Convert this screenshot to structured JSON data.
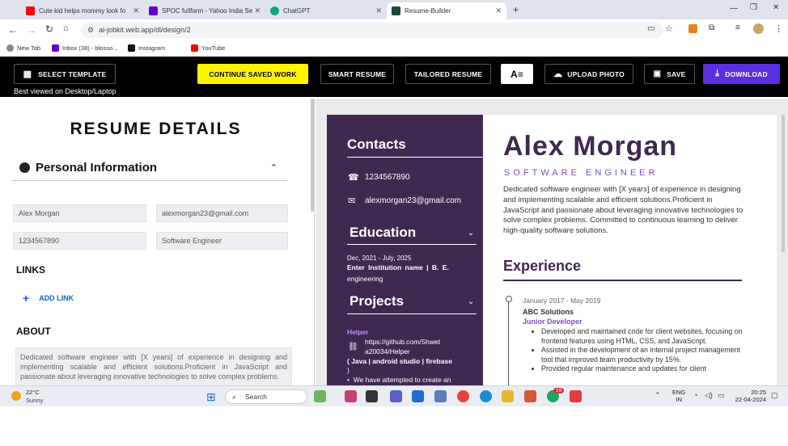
{
  "browser": {
    "tabs": [
      {
        "title": "Cute kid helps mommy look fo",
        "icon": "youtube-icon",
        "color": "#ff0000"
      },
      {
        "title": "SPOC fullform - Yahoo India Se",
        "icon": "yahoo-icon",
        "color": "#6001d2"
      },
      {
        "title": "ChatGPT",
        "icon": "chatgpt-icon",
        "color": "#10a37f"
      },
      {
        "title": "Resume-Builder",
        "icon": "app-icon",
        "color": "#1a4a3a"
      }
    ],
    "url": "ai-jobkit.web.app/dl/design/2",
    "bookmarks": [
      "New Tab",
      "Inbox (38) - blosso...",
      "Instagram",
      "YouTube"
    ]
  },
  "toolbar": {
    "select_template": "SELECT TEMPLATE",
    "continue_saved": "CONTINUE SAVED WORK",
    "smart_resume": "SMART RESUME",
    "tailored_resume": "TAILORED RESUME",
    "upload_photo": "UPLOAD PHOTO",
    "save": "SAVE",
    "download": "DOWNLOAD",
    "best_viewed": "Best viewed on Desktop/Laptop"
  },
  "form": {
    "heading": "RESUME DETAILS",
    "personal_section": "Personal Information",
    "name": "Alex Morgan",
    "email": "alexmorgan23@gmail.com",
    "phone": "1234567890",
    "role": "Software Engineer",
    "links_heading": "LINKS",
    "add_link": "ADD LINK",
    "about_heading": "ABOUT",
    "about_text": "Dedicated software engineer with [X years] of experience in designing and implementing scalable and efficient solutions.Proficient in JavaScript and passionate about leveraging innovative technologies to solve complex problems."
  },
  "resume": {
    "contacts_title": "Contacts",
    "phone": "1234567890",
    "email": "alexmorgan23@gmail.com",
    "education_title": "Education",
    "edu_dates": "Dec, 2021 - July, 2025",
    "edu_line1": "Enter Institution name | B. E.",
    "edu_line2": "engineering",
    "projects_title": "Projects",
    "project_name": "Helper",
    "project_link_line1": "https://github.com/Shwet",
    "project_link_line2": "a20034/Helper",
    "project_stack": "( Java | android studio | firebase",
    "project_stack_close": ")",
    "project_bullet": "We have attempted to create an",
    "name": "Alex Morgan",
    "title": "SOFTWARE ENGINEER",
    "summary": "Dedicated software engineer with [X years] of experience in designing and implementing scalable and efficient solutions.Proficient in JavaScript and passionate about leveraging innovative technologies to solve complex problems. Committed to continuous learning to deliver high-quality software solutions.",
    "experience_title": "Experience",
    "exp_dates": "January 2017 - May 2019",
    "exp_company": "ABC Solutions",
    "exp_role": "Junior Developer",
    "exp_bullets": [
      "Developed and maintained code for client websites, focusing on frontend features using HTML, CSS, and JavaScript.",
      "Assisted in the development of an internal project management tool that improved team productivity by 15%.",
      "Provided regular maintenance and updates for client"
    ],
    "accent": "#3f2951",
    "role_color": "#7b4fbf"
  },
  "taskbar": {
    "weather_temp": "22°C",
    "weather_cond": "Sunny",
    "search": "Search",
    "lang1": "ENG",
    "lang2": "IN",
    "time": "20:25",
    "date": "22-04-2024",
    "badge": "18"
  }
}
